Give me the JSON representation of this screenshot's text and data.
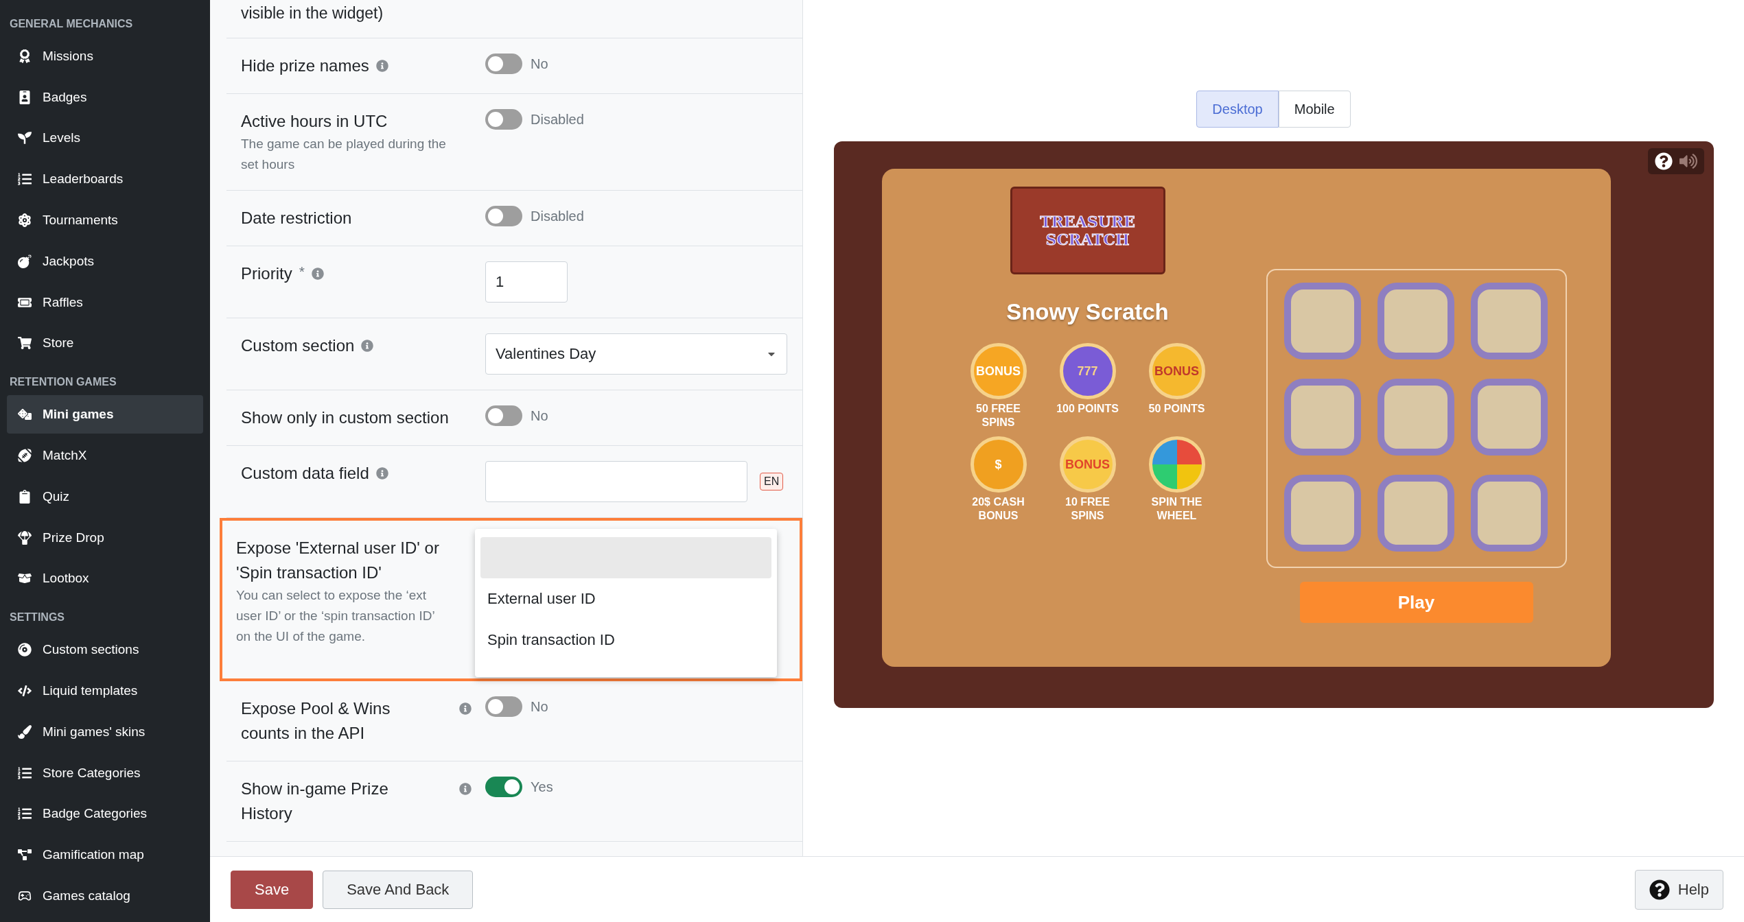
{
  "sidebar": {
    "sections": [
      {
        "title": "GENERAL MECHANICS",
        "items": [
          {
            "label": "Missions",
            "selected": false
          },
          {
            "label": "Badges",
            "selected": false
          },
          {
            "label": "Levels",
            "selected": false
          },
          {
            "label": "Leaderboards",
            "selected": false
          },
          {
            "label": "Tournaments",
            "selected": false
          },
          {
            "label": "Jackpots",
            "selected": false
          },
          {
            "label": "Raffles",
            "selected": false
          },
          {
            "label": "Store",
            "selected": false
          }
        ]
      },
      {
        "title": "RETENTION GAMES",
        "items": [
          {
            "label": "Mini games",
            "selected": true
          },
          {
            "label": "MatchX",
            "selected": false
          },
          {
            "label": "Quiz",
            "selected": false
          },
          {
            "label": "Prize Drop",
            "selected": false
          },
          {
            "label": "Lootbox",
            "selected": false
          }
        ]
      },
      {
        "title": "SETTINGS",
        "items": [
          {
            "label": "Custom sections",
            "selected": false
          },
          {
            "label": "Liquid templates",
            "selected": false
          },
          {
            "label": "Mini games' skins",
            "selected": false
          },
          {
            "label": "Store Categories",
            "selected": false
          },
          {
            "label": "Badge Categories",
            "selected": false
          },
          {
            "label": "Gamification map",
            "selected": false
          },
          {
            "label": "Games catalog",
            "selected": false
          }
        ]
      }
    ]
  },
  "form": {
    "cut_label": "visible in the widget)",
    "rows": [
      {
        "kind": "toggle",
        "label": "Hide prize names",
        "info": true,
        "on": false,
        "value": "No"
      },
      {
        "kind": "toggle",
        "label": "Active hours in UTC",
        "hint": "The game can be played during the set hours",
        "on": false,
        "value": "Disabled"
      },
      {
        "kind": "toggle",
        "label": "Date restriction",
        "on": false,
        "value": "Disabled"
      },
      {
        "kind": "input",
        "label": "Priority",
        "required": "*",
        "info": true,
        "value": "1"
      },
      {
        "kind": "select",
        "label": "Custom section",
        "info": true,
        "value": "Valentines Day"
      },
      {
        "kind": "toggle",
        "label": "Show only in custom section",
        "on": false,
        "value": "No"
      },
      {
        "kind": "lang_input",
        "label": "Custom data field",
        "info": true,
        "lang": "EN"
      },
      {
        "kind": "dropdown",
        "label": "Expose 'External user ID' or 'Spin transaction ID'",
        "hint": "You can select to expose the ‘ext user ID’ or the ‘spin transaction ID’ on the UI of the game.",
        "highlighted": true,
        "empty_option_hovered": true,
        "options": [
          {
            "label": "External user ID",
            "selected": false
          },
          {
            "label": "Spin transaction ID",
            "selected": false
          }
        ]
      },
      {
        "kind": "toggle",
        "label": "Expose Pool & Wins counts in the API",
        "info": true,
        "info_at_end": true,
        "on": false,
        "value": "No"
      },
      {
        "kind": "toggle",
        "label": "Show in-game Prize History",
        "info": true,
        "info_at_end": true,
        "on": true,
        "value": "Yes"
      }
    ]
  },
  "footer": {
    "buttons": [
      {
        "label": "Save",
        "kind": "primary"
      },
      {
        "label": "Save And Back",
        "kind": "secondary"
      }
    ],
    "help": "Help"
  },
  "preview": {
    "tabs": [
      {
        "label": "Desktop",
        "selected": true
      },
      {
        "label": "Mobile",
        "selected": false
      }
    ],
    "game": {
      "logo": [
        "TREASURE",
        "SCRATCH"
      ],
      "title": "Snowy Scratch",
      "prizes": [
        {
          "kind": "bonus-badge",
          "icon_text": "BONUS",
          "label": "50 FREE SPINS"
        },
        {
          "kind": "slot-machine",
          "icon_text": "777",
          "label": "100 POINTS"
        },
        {
          "kind": "bonus-ribbon",
          "icon_text": "BONUS",
          "label": "50 POINTS"
        },
        {
          "kind": "coin",
          "icon_text": "$",
          "label": "20$ CASH BONUS"
        },
        {
          "kind": "bonus-stars",
          "icon_text": "BONUS",
          "label": "10 FREE SPINS"
        },
        {
          "kind": "wheel",
          "label": "SPIN THE WHEEL"
        }
      ],
      "play": "Play"
    }
  }
}
